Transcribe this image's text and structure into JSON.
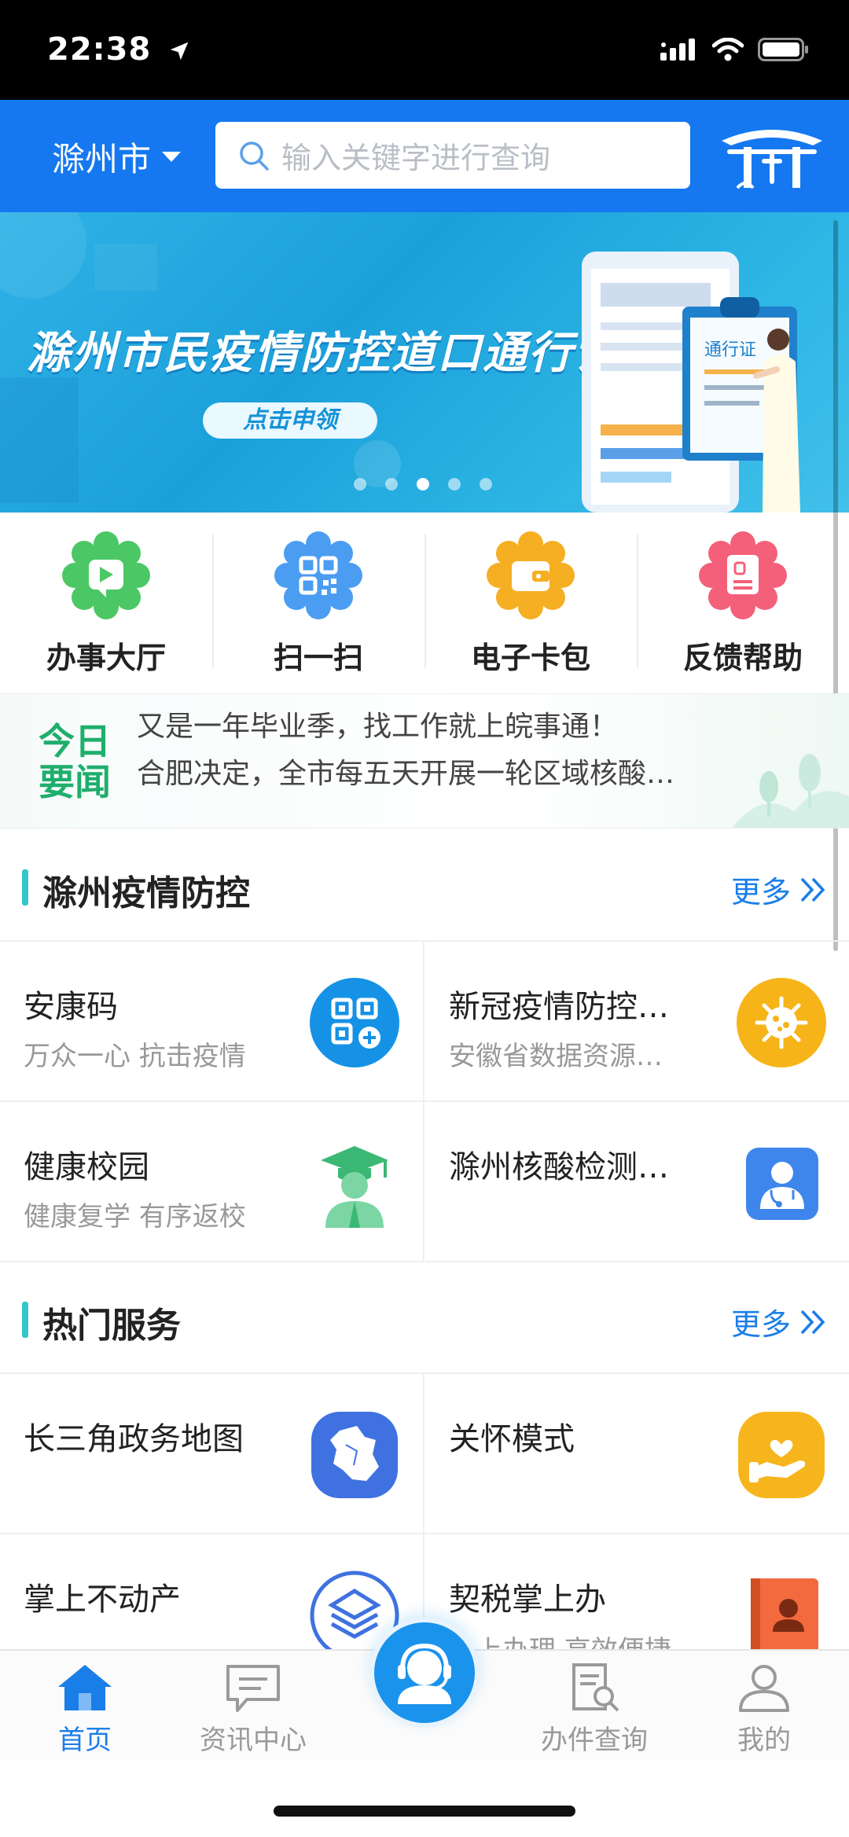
{
  "status_bar": {
    "time": "22:38"
  },
  "header": {
    "city": "滁州市",
    "search_placeholder": "输入关键字进行查询"
  },
  "banner": {
    "title": "滁州市民疫情防控道口通行证",
    "button": "点击申领",
    "card_label": "通行证",
    "active_slide": 3,
    "total_slides": 5
  },
  "quick_actions": [
    {
      "label": "办事大厅",
      "icon": "video-icon",
      "color": "#4cc766"
    },
    {
      "label": "扫一扫",
      "icon": "qrcode-icon",
      "color": "#4b9df2"
    },
    {
      "label": "电子卡包",
      "icon": "wallet-icon",
      "color": "#f6ae22"
    },
    {
      "label": "反馈帮助",
      "icon": "document-icon",
      "color": "#f4607a"
    }
  ],
  "news": {
    "badge_line1": "今日",
    "badge_line2": "要闻",
    "items": [
      "又是一年毕业季，找工作就上皖事通！",
      "合肥决定，全市每五天开展一轮区域核酸…"
    ]
  },
  "section_epidemic": {
    "title": "滁州疫情防控",
    "more": "更多",
    "cards": [
      {
        "title": "安康码",
        "subtitle": "万众一心 抗击疫情",
        "icon": "health-code-icon"
      },
      {
        "title": "新冠疫情防控…",
        "subtitle": "安徽省数据资源…",
        "icon": "virus-icon"
      },
      {
        "title": "健康校园",
        "subtitle": "健康复学 有序返校",
        "icon": "graduate-icon"
      },
      {
        "title": "滁州核酸检测…",
        "subtitle": "",
        "icon": "doctor-icon"
      }
    ]
  },
  "section_hot": {
    "title": "热门服务",
    "more": "更多",
    "cards": [
      {
        "title": "长三角政务地图",
        "subtitle": "",
        "icon": "map-icon"
      },
      {
        "title": "关怀模式",
        "subtitle": "",
        "icon": "care-icon"
      },
      {
        "title": "掌上不动产",
        "subtitle": "",
        "icon": "property-icon"
      },
      {
        "title": "契税掌上办",
        "subtitle": "…上办理 高效便捷",
        "icon": "tax-book-icon"
      }
    ]
  },
  "tabbar": {
    "items": [
      {
        "label": "首页",
        "icon": "home-icon",
        "active": true
      },
      {
        "label": "资讯中心",
        "icon": "message-icon",
        "active": false
      },
      {
        "label": "",
        "icon": "customer-service-icon",
        "active": false
      },
      {
        "label": "办件查询",
        "icon": "search-doc-icon",
        "active": false
      },
      {
        "label": "我的",
        "icon": "user-icon",
        "active": false
      }
    ]
  },
  "colors": {
    "brand_blue": "#1578f0",
    "accent_teal": "#35c5c7",
    "news_green": "#1fae6c",
    "link_blue": "#1a7ee8"
  }
}
